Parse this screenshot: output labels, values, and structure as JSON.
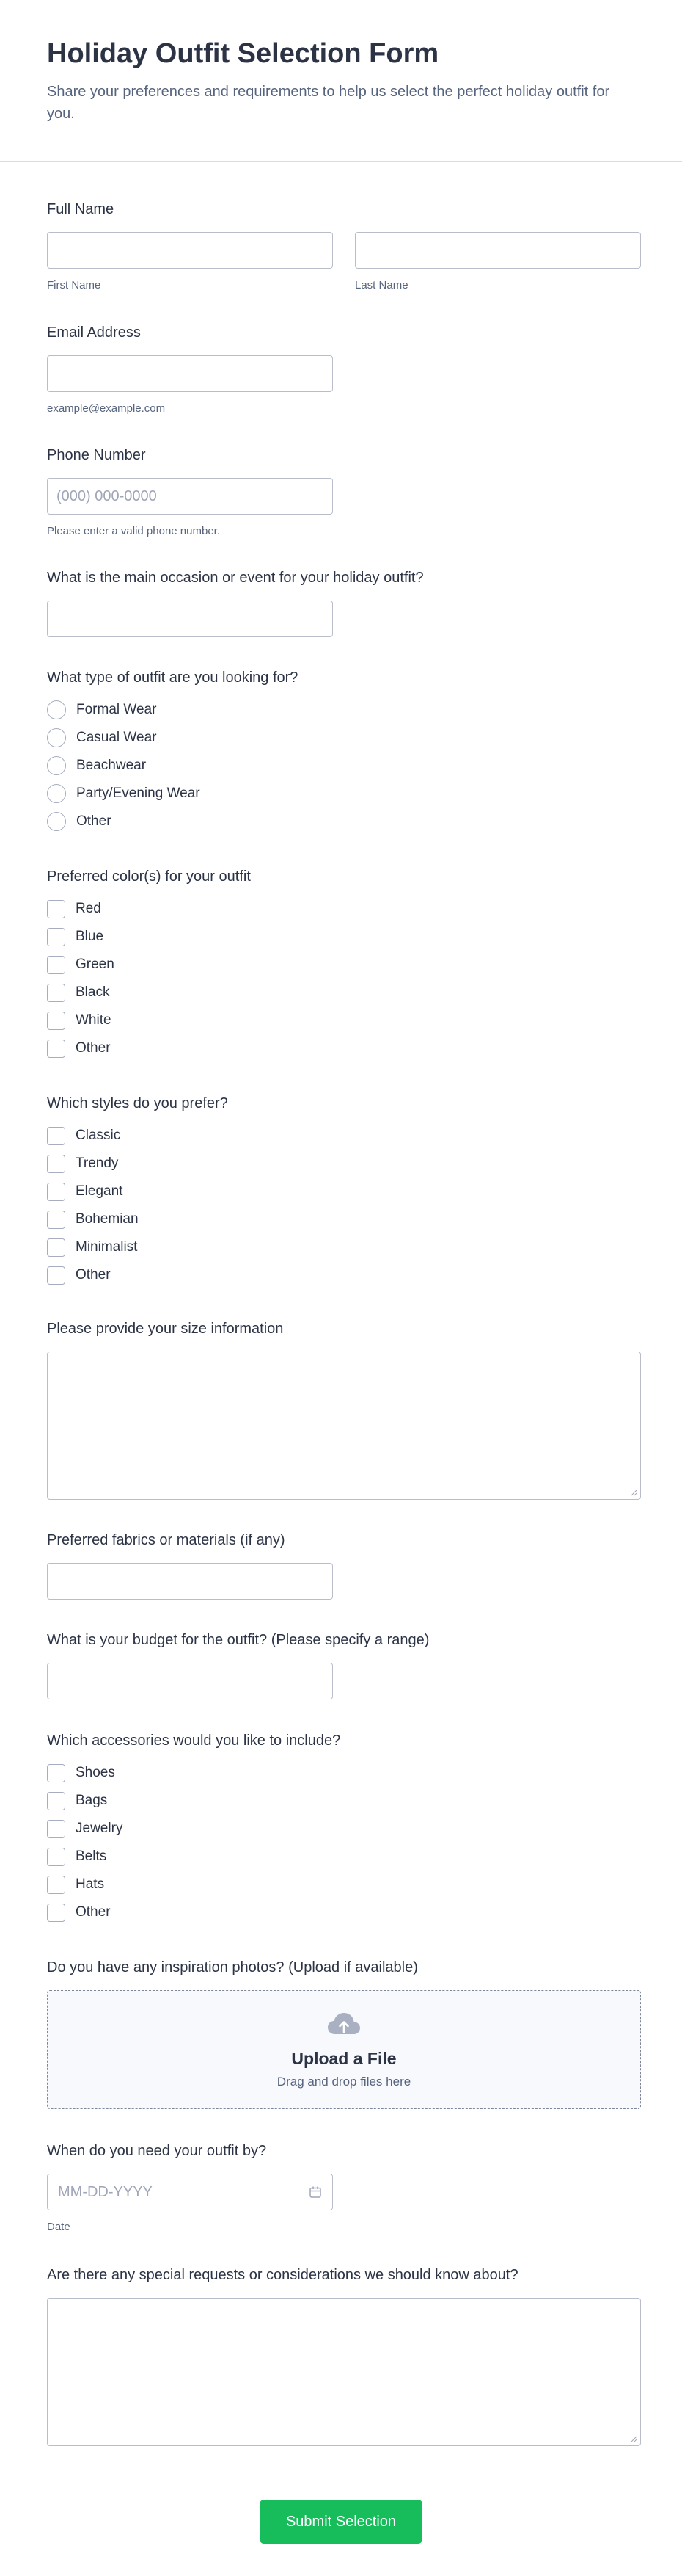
{
  "header": {
    "title": "Holiday Outfit Selection Form",
    "subtitle": "Share your preferences and requirements to help us select the perfect holiday outfit for you."
  },
  "full_name": {
    "label": "Full Name",
    "first_sublabel": "First Name",
    "last_sublabel": "Last Name"
  },
  "email": {
    "label": "Email Address",
    "sublabel": "example@example.com"
  },
  "phone": {
    "label": "Phone Number",
    "placeholder": "(000) 000-0000",
    "sublabel": "Please enter a valid phone number."
  },
  "occasion": {
    "label": "What is the main occasion or event for your holiday outfit?"
  },
  "outfit_type": {
    "label": "What type of outfit are you looking for?",
    "options": [
      "Formal Wear",
      "Casual Wear",
      "Beachwear",
      "Party/Evening Wear",
      "Other"
    ]
  },
  "colors": {
    "label": "Preferred color(s) for your outfit",
    "options": [
      "Red",
      "Blue",
      "Green",
      "Black",
      "White",
      "Other"
    ]
  },
  "styles": {
    "label": "Which styles do you prefer?",
    "options": [
      "Classic",
      "Trendy",
      "Elegant",
      "Bohemian",
      "Minimalist",
      "Other"
    ]
  },
  "size": {
    "label": "Please provide your size information"
  },
  "fabrics": {
    "label": "Preferred fabrics or materials (if any)"
  },
  "budget": {
    "label": "What is your budget for the outfit? (Please specify a range)"
  },
  "accessories": {
    "label": "Which accessories would you like to include?",
    "options": [
      "Shoes",
      "Bags",
      "Jewelry",
      "Belts",
      "Hats",
      "Other"
    ]
  },
  "upload": {
    "label": "Do you have any inspiration photos? (Upload if available)",
    "title": "Upload a File",
    "subtitle": "Drag and drop files here",
    "icon": "cloud-upload-icon"
  },
  "date": {
    "label": "When do you need your outfit by?",
    "placeholder": "MM-DD-YYYY",
    "sublabel": "Date",
    "icon": "calendar-icon"
  },
  "special": {
    "label": "Are there any special requests or considerations we should know about?"
  },
  "submit_label": "Submit Selection",
  "colors_theme": {
    "submit": "#18bd5b",
    "text": "#2c3345",
    "muted": "#57647e"
  }
}
